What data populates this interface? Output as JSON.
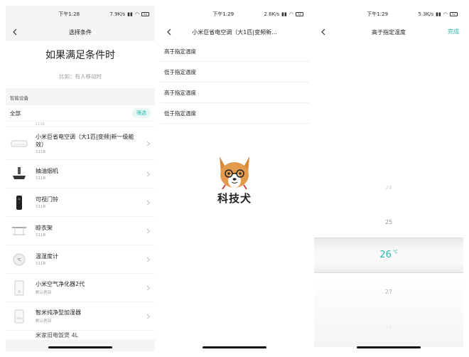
{
  "accent": "#2ab6a8",
  "phone1": {
    "status": {
      "time": "下午1:28",
      "speed": "7.9K/s",
      "battery": "52"
    },
    "title": "选择条件",
    "hero_title": "如果满足条件时",
    "hero_sub": "比如：有人移动时",
    "section_label": "智能设备",
    "filter_all": "全部",
    "filter_button": "筛选",
    "partial_top": "1118",
    "devices": [
      {
        "name": "小米巨省电空调（大1匹|变频|新一级能效）",
        "room": "1118",
        "icon": "air-conditioner-icon"
      },
      {
        "name": "抽油烟机",
        "room": "1118",
        "icon": "range-hood-icon"
      },
      {
        "name": "可视门铃",
        "room": "1118",
        "icon": "doorbell-icon"
      },
      {
        "name": "晾衣架",
        "room": "1118",
        "icon": "clothes-rack-icon"
      },
      {
        "name": "温湿度计",
        "room": "1118",
        "icon": "thermometer-icon"
      },
      {
        "name": "小米空气净化器2代",
        "room": "默认房间",
        "icon": "air-purifier-icon"
      },
      {
        "name": "智米纯净型加湿器",
        "room": "默认房间",
        "icon": "humidifier-icon"
      }
    ],
    "partial_bottom": "米家旧电饭煲 4L"
  },
  "phone2": {
    "status": {
      "time": "下午1:29",
      "speed": "2.6K/s",
      "battery": "52"
    },
    "title": "小米巨省电空调（大1匹|变频新...",
    "options": [
      "高于指定温度",
      "低于指定温度",
      "高于指定温度",
      "低于指定温度"
    ],
    "watermark_text": "科技犬"
  },
  "phone3": {
    "status": {
      "time": "下午1:29",
      "speed": "5.3K/s",
      "battery": "52"
    },
    "title": "高于指定温度",
    "done": "完成",
    "picker": {
      "above2": "24",
      "above1": "25",
      "selected": "26",
      "unit": "℃",
      "below1": "27",
      "below2": "28"
    }
  }
}
